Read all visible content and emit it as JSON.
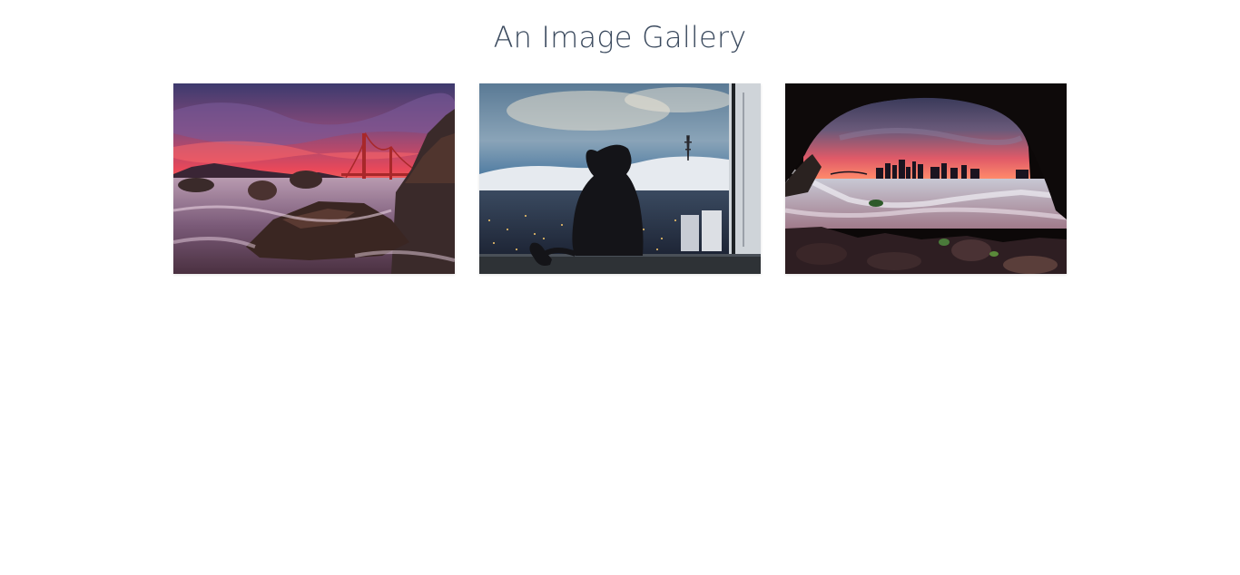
{
  "page": {
    "title": "An Image Gallery"
  },
  "gallery": {
    "images": [
      {
        "subject": "Golden Gate Bridge at sunset from a rocky beach",
        "icon": "photo-sunset-bridge"
      },
      {
        "subject": "Silhouette of a monkey figure at a window overlooking a foggy city",
        "icon": "photo-window-city"
      },
      {
        "subject": "City skyline viewed through a sea cave at dusk",
        "icon": "photo-cave-skyline"
      }
    ]
  },
  "colors": {
    "title_text": "#3b4a5e",
    "background": "#ffffff"
  }
}
